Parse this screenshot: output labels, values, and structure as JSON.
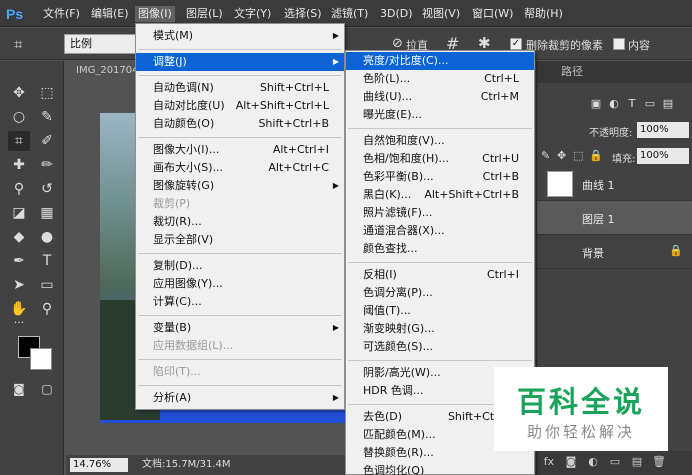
{
  "app": {
    "logo": "Ps"
  },
  "menubar": {
    "items": [
      "文件(F)",
      "编辑(E)",
      "图像(I)",
      "图层(L)",
      "文字(Y)",
      "选择(S)",
      "滤镜(T)",
      "3D(D)",
      "视图(V)",
      "窗口(W)",
      "帮助(H)"
    ],
    "active_index": 2
  },
  "options": {
    "ratio_value": "比例",
    "straighten_label": "拉直",
    "delete_cropped_label": "删除裁剪的像素",
    "delete_cropped_checked": true,
    "content_aware_label": "内容"
  },
  "document": {
    "tab_title": "IMG_201704",
    "zoom": "14.76%",
    "doc_size": "文档:15.7M/31.4M"
  },
  "image_menu": {
    "items": [
      {
        "label": "模式(M)",
        "shortcut": "",
        "submenu": true,
        "disabled": false
      },
      {
        "sep": true
      },
      {
        "label": "调整(J)",
        "shortcut": "",
        "submenu": true,
        "disabled": false,
        "highlighted": true
      },
      {
        "sep": true
      },
      {
        "label": "自动色调(N)",
        "shortcut": "Shift+Ctrl+L",
        "disabled": false
      },
      {
        "label": "自动对比度(U)",
        "shortcut": "Alt+Shift+Ctrl+L",
        "disabled": false
      },
      {
        "label": "自动颜色(O)",
        "shortcut": "Shift+Ctrl+B",
        "disabled": false
      },
      {
        "sep": true
      },
      {
        "label": "图像大小(I)...",
        "shortcut": "Alt+Ctrl+I",
        "disabled": false
      },
      {
        "label": "画布大小(S)...",
        "shortcut": "Alt+Ctrl+C",
        "disabled": false
      },
      {
        "label": "图像旋转(G)",
        "shortcut": "",
        "submenu": true,
        "disabled": false
      },
      {
        "label": "裁剪(P)",
        "shortcut": "",
        "disabled": true
      },
      {
        "label": "裁切(R)...",
        "shortcut": "",
        "disabled": false
      },
      {
        "label": "显示全部(V)",
        "shortcut": "",
        "disabled": false
      },
      {
        "sep": true
      },
      {
        "label": "复制(D)...",
        "shortcut": "",
        "disabled": false
      },
      {
        "label": "应用图像(Y)...",
        "shortcut": "",
        "disabled": false
      },
      {
        "label": "计算(C)...",
        "shortcut": "",
        "disabled": false
      },
      {
        "sep": true
      },
      {
        "label": "变量(B)",
        "shortcut": "",
        "submenu": true,
        "disabled": false
      },
      {
        "label": "应用数据组(L)...",
        "shortcut": "",
        "disabled": true
      },
      {
        "sep": true
      },
      {
        "label": "陷印(T)...",
        "shortcut": "",
        "disabled": true
      },
      {
        "sep": true
      },
      {
        "label": "分析(A)",
        "shortcut": "",
        "submenu": true,
        "disabled": false
      }
    ]
  },
  "adjust_menu": {
    "items": [
      {
        "label": "亮度/对比度(C)...",
        "shortcut": "",
        "highlighted": true
      },
      {
        "label": "色阶(L)...",
        "shortcut": "Ctrl+L"
      },
      {
        "label": "曲线(U)...",
        "shortcut": "Ctrl+M"
      },
      {
        "label": "曝光度(E)...",
        "shortcut": ""
      },
      {
        "sep": true
      },
      {
        "label": "自然饱和度(V)...",
        "shortcut": ""
      },
      {
        "label": "色相/饱和度(H)...",
        "shortcut": "Ctrl+U"
      },
      {
        "label": "色彩平衡(B)...",
        "shortcut": "Ctrl+B"
      },
      {
        "label": "黑白(K)...",
        "shortcut": "Alt+Shift+Ctrl+B"
      },
      {
        "label": "照片滤镜(F)...",
        "shortcut": ""
      },
      {
        "label": "通道混合器(X)...",
        "shortcut": ""
      },
      {
        "label": "颜色查找...",
        "shortcut": ""
      },
      {
        "sep": true
      },
      {
        "label": "反相(I)",
        "shortcut": "Ctrl+I"
      },
      {
        "label": "色调分离(P)...",
        "shortcut": ""
      },
      {
        "label": "阈值(T)...",
        "shortcut": ""
      },
      {
        "label": "渐变映射(G)...",
        "shortcut": ""
      },
      {
        "label": "可选颜色(S)...",
        "shortcut": ""
      },
      {
        "sep": true
      },
      {
        "label": "阴影/高光(W)...",
        "shortcut": ""
      },
      {
        "label": "HDR 色调...",
        "shortcut": ""
      },
      {
        "sep": true
      },
      {
        "label": "去色(D)",
        "shortcut": "Shift+Ctrl+U"
      },
      {
        "label": "匹配颜色(M)...",
        "shortcut": ""
      },
      {
        "label": "替换颜色(R)...",
        "shortcut": ""
      },
      {
        "label": "色调均化(Q)",
        "shortcut": ""
      }
    ]
  },
  "panel": {
    "tab_paths": "路径",
    "opacity_label": "不透明度:",
    "opacity_value": "100%",
    "fill_label": "填充:",
    "fill_value": "100%",
    "layers": [
      {
        "name": "曲线 1",
        "thumb": true,
        "selected": false
      },
      {
        "name": "图层 1",
        "thumb": false,
        "selected": true
      },
      {
        "name": "背景",
        "thumb": false,
        "selected": false,
        "locked": true
      }
    ]
  },
  "watermark": {
    "title": "百科全说",
    "subtitle": "助你轻松解决"
  },
  "colors": {
    "accent": "#0b63d6",
    "watermark_green": "#1aa35a"
  }
}
